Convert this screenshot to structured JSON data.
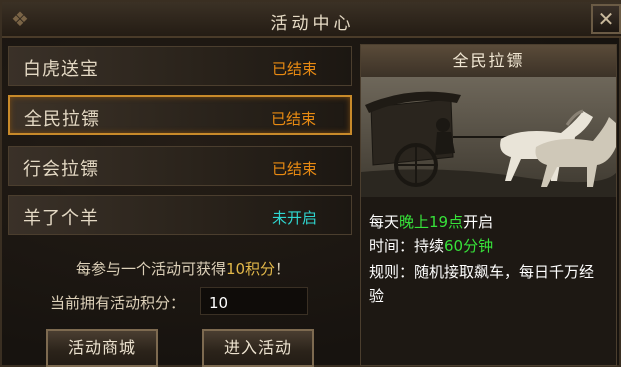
{
  "window": {
    "title": "活动中心",
    "close_glyph": "✕",
    "ornament_glyph": "❖"
  },
  "activities": [
    {
      "name": "白虎送宝",
      "status": "已结束",
      "status_color": "#e88a12",
      "selected": false
    },
    {
      "name": "全民拉镖",
      "status": "已结束",
      "status_color": "#e88a12",
      "selected": true
    },
    {
      "name": "行会拉镖",
      "status": "已结束",
      "status_color": "#e88a12",
      "selected": false
    },
    {
      "name": "羊了个羊",
      "status": "未开启",
      "status_color": "#2fd6d0",
      "selected": false
    }
  ],
  "points": {
    "prefix": "每参与一个活动可获得",
    "highlight": "10积分",
    "suffix": "！",
    "current_label": "当前拥有活动积分：",
    "current_value": "10"
  },
  "buttons": {
    "shop": "活动商城",
    "enter": "进入活动"
  },
  "detail": {
    "title": "全民拉镖",
    "line1_prefix": "每天",
    "line1_highlight": "晚上19点",
    "line1_suffix": "开启",
    "line2_prefix": "时间：持续",
    "line2_highlight": "60分钟",
    "line3": "规则：随机接取飙车，每日千万经",
    "line4": "验"
  },
  "colors": {
    "accent_gold": "#c88a2a",
    "highlight_green": "#37e23a",
    "ended_orange": "#e88a12",
    "notstarted_cyan": "#2fd6d0"
  }
}
